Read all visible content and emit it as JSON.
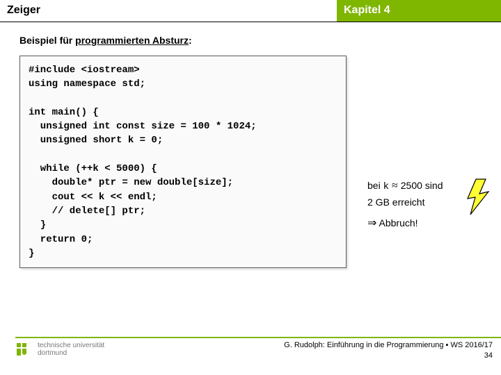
{
  "header": {
    "left": "Zeiger",
    "right": "Kapitel 4"
  },
  "subtitle": {
    "prefix": "Beispiel für ",
    "underlined": "programmierten Absturz",
    "suffix": ":"
  },
  "code": "#include <iostream>\nusing namespace std;\n\nint main() {\n  unsigned int const size = 100 * 1024;\n  unsigned short k = 0;\n\n  while (++k < 5000) {\n    double* ptr = new double[size];\n    cout << k << endl;\n    // delete[] ptr;\n  }\n  return 0;\n}",
  "annotation": {
    "line1_prefix": "bei ",
    "line1_var": "k",
    "line1_approx": " ≈ ",
    "line1_value": "2500 sind",
    "line2": "2 GB erreicht",
    "arrow": "⇒",
    "abort": " Abbruch!"
  },
  "icons": {
    "bolt": "lightning-bolt-icon",
    "logo": "tu-dortmund-logo"
  },
  "logo": {
    "line1": "technische universität",
    "line2": "dortmund"
  },
  "footer": {
    "credit": "G. Rudolph: Einführung in die Programmierung ▪ WS 2016/17",
    "page": "34"
  }
}
